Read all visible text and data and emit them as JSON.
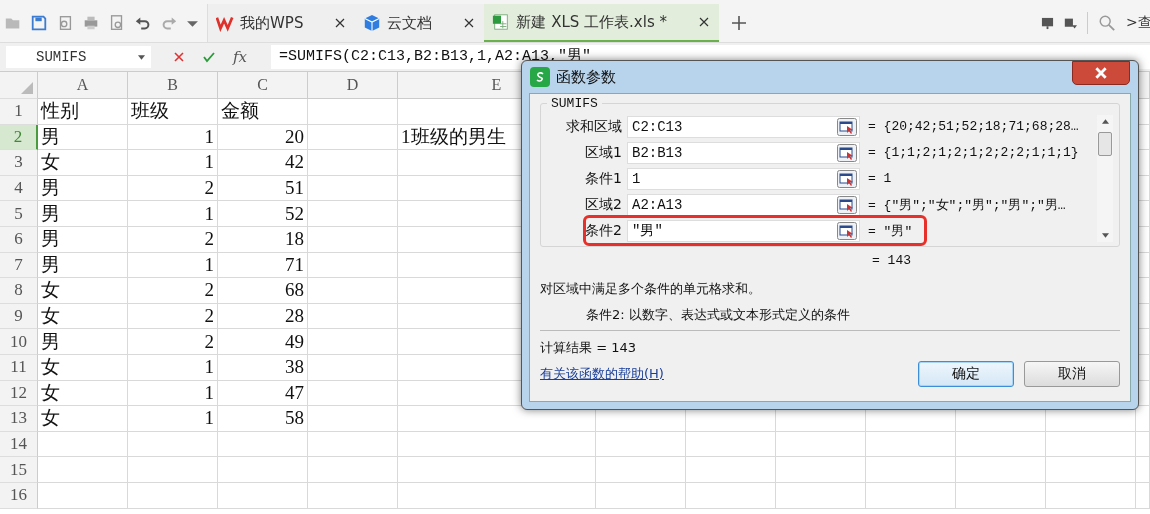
{
  "toolbar": {
    "tabs": [
      {
        "label": "我的WPS",
        "kind": "wps",
        "selected": false
      },
      {
        "label": "云文档",
        "kind": "cloud",
        "selected": false
      },
      {
        "label": "新建 XLS 工作表.xls *",
        "kind": "sheet",
        "selected": true
      }
    ],
    "search_hint": ">查"
  },
  "formula_bar": {
    "name_box": "SUMIFS",
    "fx": "fx",
    "formula": "=SUMIFS(C2:C13,B2:B13,1,A2:A13,″男″"
  },
  "sheet": {
    "columns": [
      "A",
      "B",
      "C",
      "D",
      "E"
    ],
    "rows": [
      {
        "number": "1",
        "selected": false,
        "kind": "header",
        "a": "性别",
        "b": "班级",
        "c": "金额"
      },
      {
        "number": "2",
        "selected": true,
        "a": "男",
        "b": "1",
        "c": "20",
        "e": "1班级的男生"
      },
      {
        "number": "3",
        "selected": false,
        "a": "女",
        "b": "1",
        "c": "42"
      },
      {
        "number": "4",
        "selected": false,
        "a": "男",
        "b": "2",
        "c": "51"
      },
      {
        "number": "5",
        "selected": false,
        "a": "男",
        "b": "1",
        "c": "52"
      },
      {
        "number": "6",
        "selected": false,
        "a": "男",
        "b": "2",
        "c": "18"
      },
      {
        "number": "7",
        "selected": false,
        "a": "男",
        "b": "1",
        "c": "71"
      },
      {
        "number": "8",
        "selected": false,
        "a": "女",
        "b": "2",
        "c": "68"
      },
      {
        "number": "9",
        "selected": false,
        "a": "女",
        "b": "2",
        "c": "28"
      },
      {
        "number": "10",
        "selected": false,
        "a": "男",
        "b": "2",
        "c": "49"
      },
      {
        "number": "11",
        "selected": false,
        "a": "女",
        "b": "1",
        "c": "38"
      },
      {
        "number": "12",
        "selected": false,
        "a": "女",
        "b": "1",
        "c": "47"
      },
      {
        "number": "13",
        "selected": false,
        "a": "女",
        "b": "1",
        "c": "58"
      },
      {
        "number": "14",
        "selected": false
      },
      {
        "number": "15",
        "selected": false
      },
      {
        "number": "16",
        "selected": false
      }
    ]
  },
  "dialog": {
    "title": "函数参数",
    "function": "SUMIFS",
    "args": [
      {
        "label": "求和区域",
        "value": "C2:C13",
        "result": "= {20;42;51;52;18;71;68;28…",
        "highlighted": false
      },
      {
        "label": "区域1",
        "value": "B2:B13",
        "result": "= {1;1;2;1;2;1;2;2;2;1;1;1}",
        "highlighted": false
      },
      {
        "label": "条件1",
        "value": "1",
        "result": "= 1",
        "highlighted": false
      },
      {
        "label": "区域2",
        "value": "A2:A13",
        "result": "= {″男″;″女″;″男″;″男″;″男…",
        "highlighted": false
      },
      {
        "label": "条件2",
        "value": "″男″",
        "result": "= ″男″",
        "highlighted": true
      }
    ],
    "formula_result": "= 143",
    "description": "对区域中满足多个条件的单元格求和。",
    "arg_help": "条件2: 以数字、表达式或文本形式定义的条件",
    "calc_result": "计算结果 = 143",
    "help_link": "有关该函数的帮助(H)",
    "buttons": [
      {
        "label": "确定",
        "default": true
      },
      {
        "label": "取消",
        "default": false
      }
    ]
  }
}
